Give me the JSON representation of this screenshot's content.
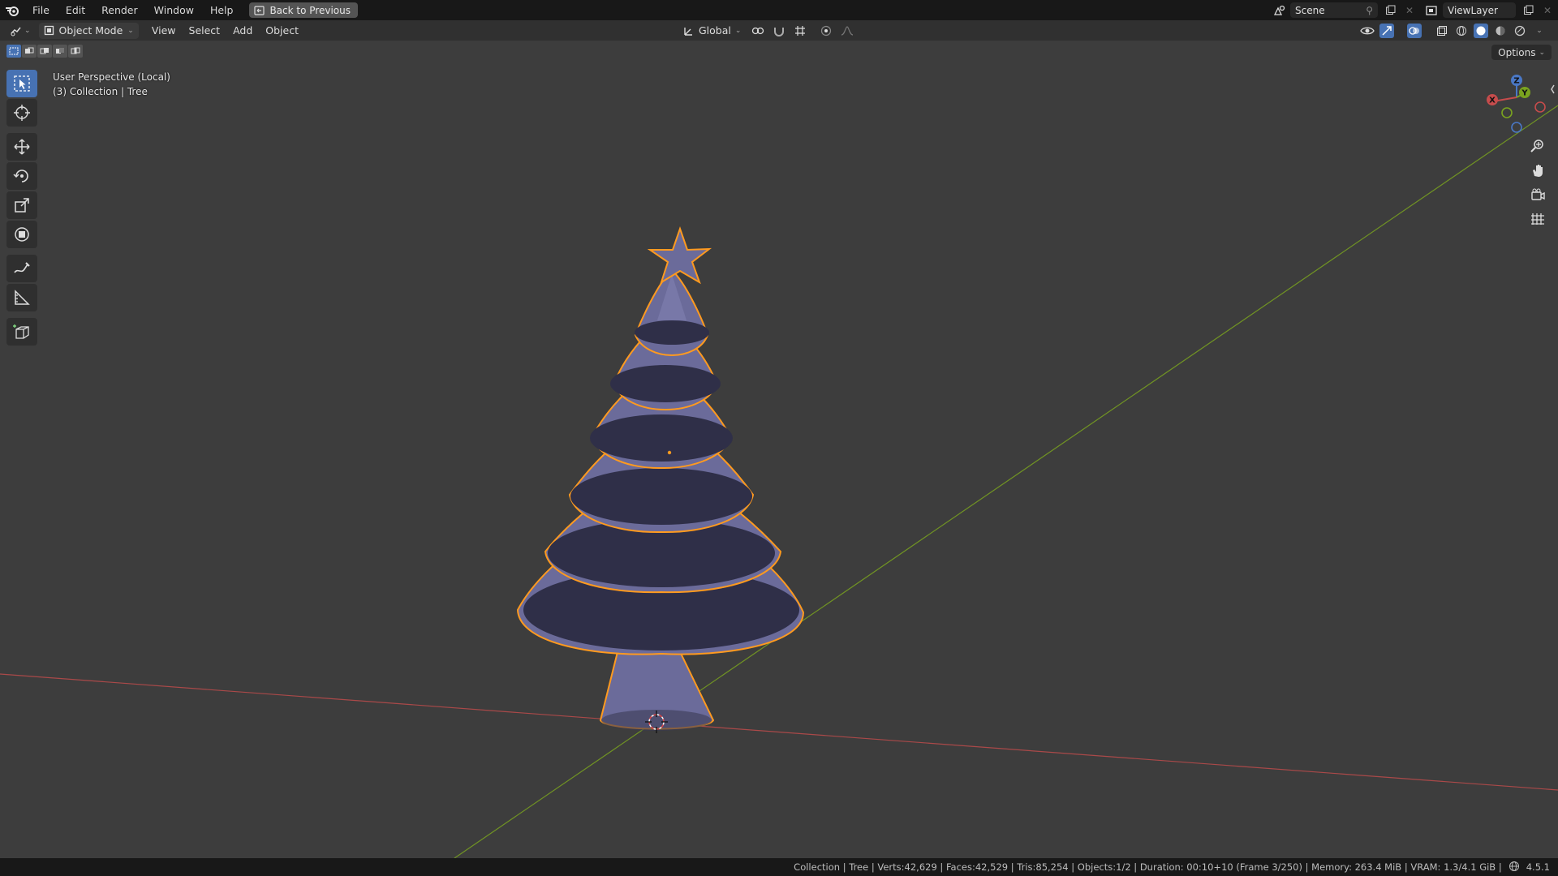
{
  "menubar": {
    "items": [
      "File",
      "Edit",
      "Render",
      "Window",
      "Help"
    ],
    "back_button": "Back to Previous",
    "scene_label": "Scene",
    "viewlayer_label": "ViewLayer"
  },
  "header": {
    "mode": "Object Mode",
    "menus": [
      "View",
      "Select",
      "Add",
      "Object"
    ],
    "transform_orientation": "Global",
    "options_label": "Options"
  },
  "viewport": {
    "perspective_label": "User Perspective (Local)",
    "collection_label": "(3) Collection | Tree",
    "gizmo_axes": {
      "x": "X",
      "y": "Y",
      "z": "Z"
    }
  },
  "status": {
    "text": "Collection | Tree | Verts:42,629 | Faces:42,529 | Tris:85,254 | Objects:1/2 | Duration: 00:10+10 (Frame 3/250) | Memory: 263.4 MiB | VRAM: 1.3/4.1 GiB |",
    "version": "4.5.1"
  },
  "colors": {
    "selection_outline": "#ff9a1f",
    "tree_fill": "#6b6b9a",
    "x_axis": "#c64c4c",
    "y_axis": "#7aa31f",
    "active_tool": "#4772b3"
  },
  "icons": [
    "blender-logo-icon",
    "editor-type-icon",
    "cursor-icon",
    "move-icon",
    "rotate-icon",
    "scale-icon",
    "transform-icon",
    "annotate-icon",
    "measure-icon",
    "add-cube-icon",
    "zoom-icon",
    "pan-hand-icon",
    "camera-icon",
    "grid-icon"
  ]
}
